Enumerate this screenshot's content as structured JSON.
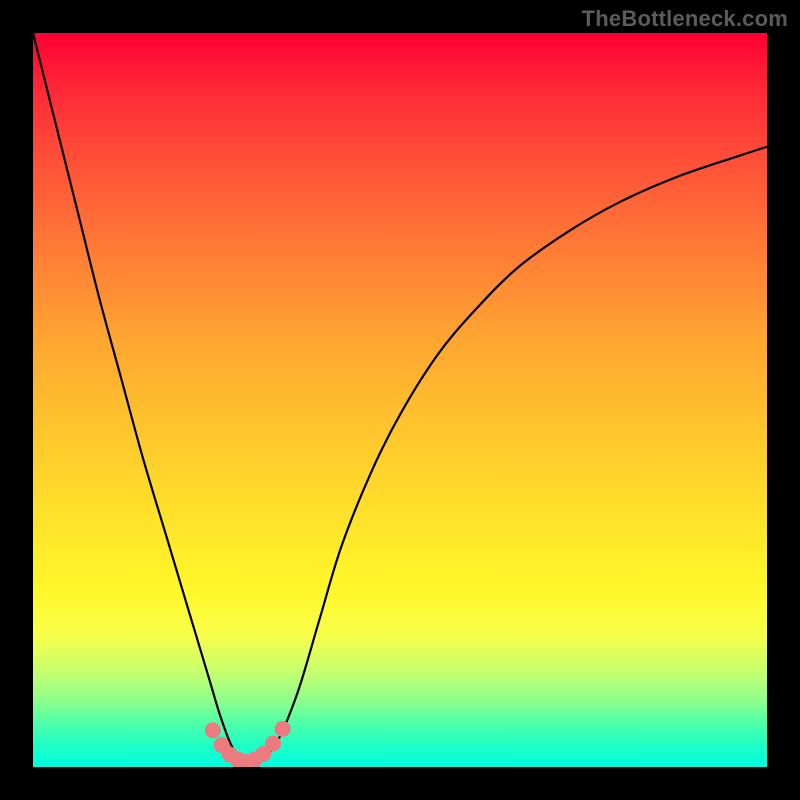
{
  "watermark": "TheBottleneck.com",
  "chart_data": {
    "type": "line",
    "title": "",
    "xlabel": "",
    "ylabel": "",
    "xlim": [
      0,
      100
    ],
    "ylim": [
      0,
      100
    ],
    "grid": false,
    "series": [
      {
        "name": "curve",
        "x": [
          0,
          3,
          6,
          9,
          12,
          15,
          18,
          21,
          24,
          25.5,
          27,
          28.5,
          30,
          33,
          36,
          39,
          42,
          46,
          50,
          55,
          60,
          66,
          73,
          80,
          88,
          96,
          100
        ],
        "y": [
          100,
          88,
          76,
          64,
          53,
          42,
          32,
          22,
          12,
          7,
          3,
          1,
          0.3,
          3,
          10,
          20,
          30,
          40,
          48,
          56,
          62,
          68,
          73,
          77,
          80.5,
          83.2,
          84.5
        ]
      }
    ],
    "markers": {
      "name": "valley-dots",
      "color": "#ec7b80",
      "x": [
        24.5,
        25.7,
        26.8,
        27.9,
        29.0,
        30.2,
        31.4,
        32.7,
        34.0
      ],
      "y": [
        5.0,
        3.0,
        1.7,
        1.0,
        0.7,
        1.0,
        1.8,
        3.2,
        5.2
      ]
    },
    "background_gradient": {
      "type": "vertical",
      "stops": [
        {
          "pos": 0.0,
          "color": "#ff0033"
        },
        {
          "pos": 0.18,
          "color": "#ff5238"
        },
        {
          "pos": 0.42,
          "color": "#ffa631"
        },
        {
          "pos": 0.66,
          "color": "#ffe22a"
        },
        {
          "pos": 0.82,
          "color": "#f8ff4a"
        },
        {
          "pos": 0.91,
          "color": "#8cff8c"
        },
        {
          "pos": 1.0,
          "color": "#00ffdf"
        }
      ]
    }
  }
}
